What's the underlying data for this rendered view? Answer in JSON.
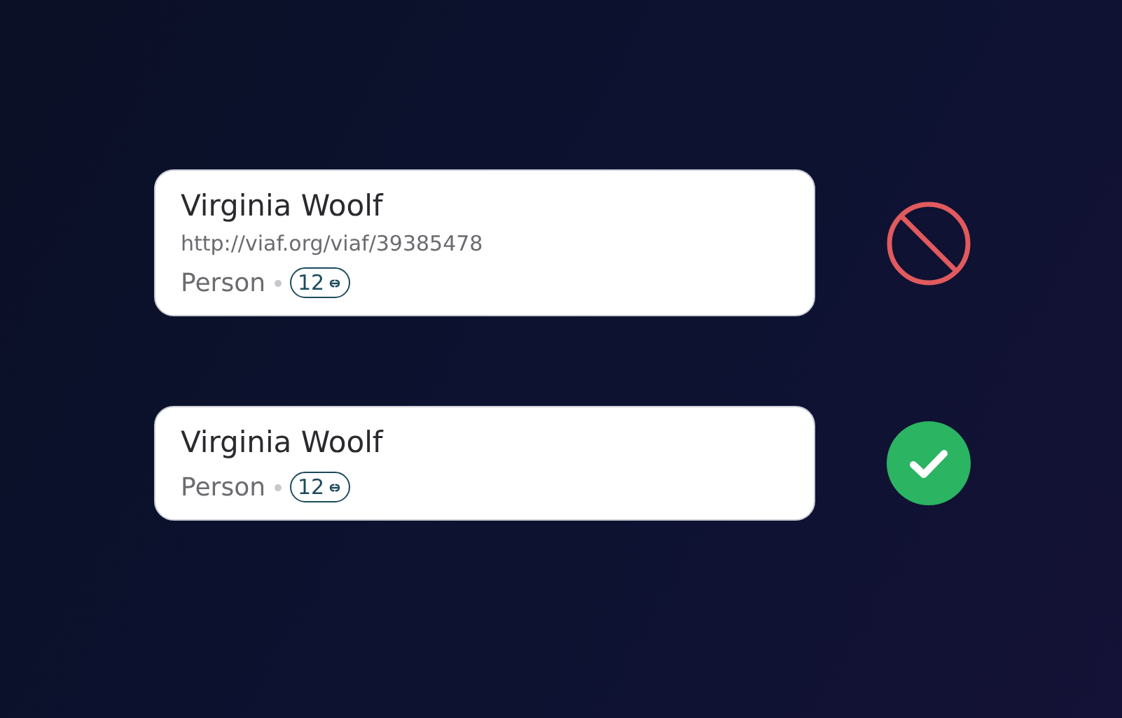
{
  "records": [
    {
      "name": "Virginia Woolf",
      "url": "http://viaf.org/viaf/39385478",
      "type": "Person",
      "link_count": "12",
      "accepted": false
    },
    {
      "name": "Virginia Woolf",
      "type": "Person",
      "link_count": "12",
      "accepted": true
    }
  ]
}
